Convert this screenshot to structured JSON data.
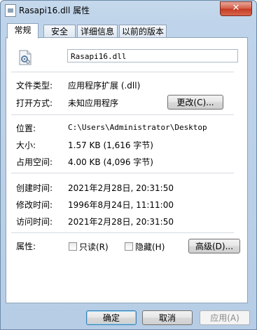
{
  "window": {
    "title": "Rasapi16.dll 属性",
    "close_glyph": "✕"
  },
  "tabs": [
    {
      "label": "常规",
      "active": true
    },
    {
      "label": "安全",
      "active": false
    },
    {
      "label": "详细信息",
      "active": false
    },
    {
      "label": "以前的版本",
      "active": false
    }
  ],
  "general": {
    "file_name": "Rasapi16.dll",
    "file_type_label": "文件类型:",
    "file_type_value": "应用程序扩展 (.dll)",
    "opens_with_label": "打开方式:",
    "opens_with_value": "未知应用程序",
    "change_button": "更改(C)...",
    "location_label": "位置:",
    "location_value": "C:\\Users\\Administrator\\Desktop",
    "size_label": "大小:",
    "size_value": "1.57 KB (1,616 字节)",
    "size_on_disk_label": "占用空间:",
    "size_on_disk_value": "4.00 KB (4,096 字节)",
    "created_label": "创建时间:",
    "created_value": "2021年2月28日, 20:31:50",
    "modified_label": "修改时间:",
    "modified_value": "1996年8月24日, 11:11:00",
    "accessed_label": "访问时间:",
    "accessed_value": "2021年2月28日, 20:31:50",
    "attributes_label": "属性:",
    "readonly_label": "只读(R)",
    "readonly_checked": false,
    "hidden_label": "隐藏(H)",
    "hidden_checked": false,
    "advanced_button": "高级(D)..."
  },
  "footer": {
    "ok_button": "确定",
    "cancel_button": "取消",
    "apply_button": "应用(A)"
  }
}
